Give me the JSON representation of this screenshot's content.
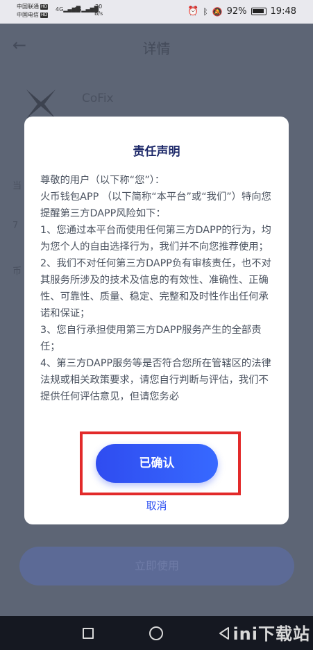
{
  "status_bar": {
    "carrier1": "中国联通",
    "carrier2": "中国电信",
    "hd_badge": "HD",
    "signal1": "4G",
    "signal2": "4G",
    "speed_value": "20",
    "speed_unit": "B/s",
    "battery": "92%",
    "time": "19:48"
  },
  "background": {
    "page_title": "详情",
    "dapp_name": "CoFix",
    "use_now_label": "立即使用",
    "side_letters": [
      "当",
      "7",
      "币"
    ]
  },
  "modal": {
    "title": "责任声明",
    "paragraphs": [
      "尊敬的用户（以下称“您”）：",
      "火币钱包APP （以下简称“本平台”或“我们”）特向您提醒第三方DAPP风险如下：",
      "1、您通过本平台而使用任何第三方DAPP的行为，均为您个人的自由选择行为，我们并不向您推荐使用；",
      "2、我们不对任何第三方DAPP负有审核责任，也不对其服务所涉及的技术及信息的有效性、准确性、正确性、可靠性、质量、稳定、完整和及时性作出任何承诺和保证；",
      "3、您自行承担使用第三方DAPP服务产生的全部责任；",
      "4、第三方DAPP服务等是否符合您所在管辖区的法律法规或相关政策要求，请您自行判断与评估，我们不提供任何评估意见，但请您务必"
    ],
    "confirm_label": "已确认",
    "cancel_label": "取消"
  },
  "navbar": {
    "watermark": "ini下载站"
  },
  "colors": {
    "accent": "#3769ff",
    "highlight": "#e22a2a",
    "title": "#1e2a6a"
  }
}
